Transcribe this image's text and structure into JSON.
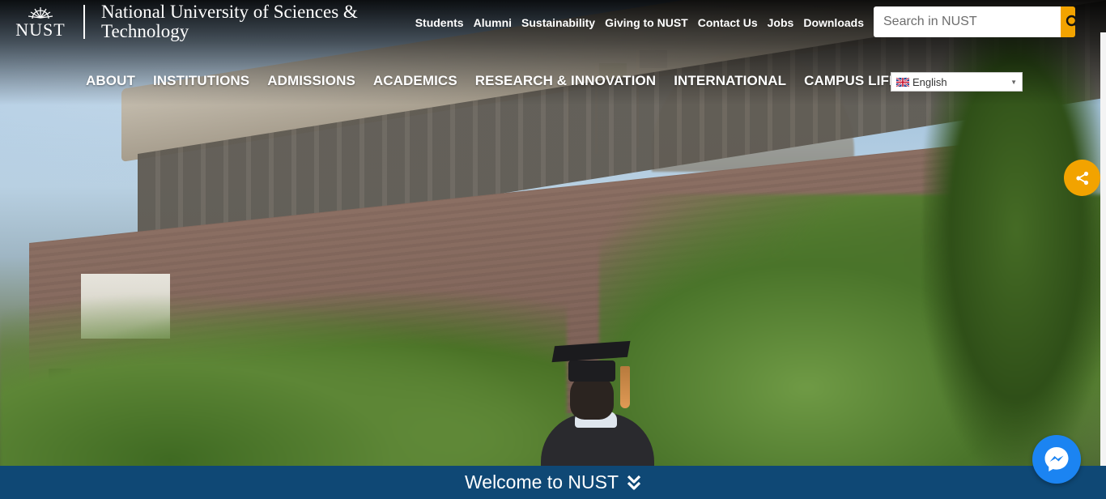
{
  "header": {
    "logo_text": "NUST",
    "university_name": "National University of Sciences & Technology"
  },
  "top_links": [
    "Students",
    "Alumni",
    "Sustainability",
    "Giving to NUST",
    "Contact Us",
    "Jobs",
    "Downloads"
  ],
  "search": {
    "placeholder": "Search in NUST",
    "icon": "search-icon"
  },
  "main_nav": [
    "ABOUT",
    "INSTITUTIONS",
    "ADMISSIONS",
    "ACADEMICS",
    "RESEARCH & INNOVATION",
    "INTERNATIONAL",
    "CAMPUS LIFE"
  ],
  "language": {
    "selected": "English"
  },
  "welcome": {
    "label": "Welcome to NUST",
    "icon": "double-chevron-down-icon"
  },
  "floating": {
    "share_icon": "share-icon",
    "messenger_icon": "messenger-icon"
  },
  "colors": {
    "accent": "#f2a300",
    "bar": "#0f4875",
    "messenger": "#1b84f2"
  }
}
